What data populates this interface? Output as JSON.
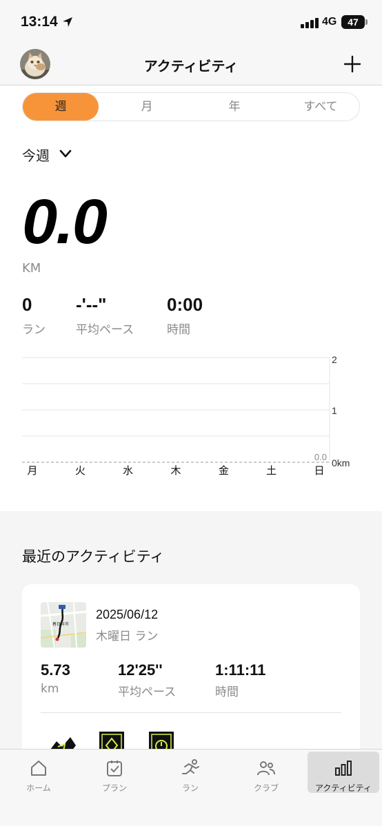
{
  "status_bar": {
    "time": "13:14",
    "network": "4G",
    "battery": "47"
  },
  "nav": {
    "title": "アクティビティ"
  },
  "period_tabs": [
    {
      "label": "週",
      "active": true
    },
    {
      "label": "月",
      "active": false
    },
    {
      "label": "年",
      "active": false
    },
    {
      "label": "すべて",
      "active": false
    }
  ],
  "period_select": {
    "label": "今週"
  },
  "summary": {
    "distance": "0.0",
    "unit": "KM",
    "stats": [
      {
        "value": "0",
        "label": "ラン"
      },
      {
        "value": "-'--\"",
        "label": "平均ペース"
      },
      {
        "value": "0:00",
        "label": "時間"
      }
    ]
  },
  "chart_data": {
    "type": "bar",
    "categories": [
      "月",
      "火",
      "水",
      "木",
      "金",
      "土",
      "日"
    ],
    "values": [
      0,
      0,
      0,
      0,
      0,
      0,
      0
    ],
    "y_ticks": [
      "2",
      "1",
      "0km"
    ],
    "ylim": [
      0,
      2
    ],
    "average_label": "0.0",
    "grid": true
  },
  "recent": {
    "title": "最近のアクティビティ",
    "activity": {
      "date": "2025/06/12",
      "type": "木曜日 ラン",
      "map_label": "春日井市",
      "stats": [
        {
          "value": "5.73",
          "label": "km"
        },
        {
          "value": "12'25''",
          "label": "平均ペース"
        },
        {
          "value": "1:11:11",
          "label": "時間"
        }
      ]
    }
  },
  "tabbar": [
    {
      "label": "ホーム",
      "icon": "home-icon",
      "active": false
    },
    {
      "label": "プラン",
      "icon": "plan-icon",
      "active": false
    },
    {
      "label": "ラン",
      "icon": "run-icon",
      "active": false
    },
    {
      "label": "クラブ",
      "icon": "club-icon",
      "active": false
    },
    {
      "label": "アクティビティ",
      "icon": "activity-icon",
      "active": true
    }
  ]
}
